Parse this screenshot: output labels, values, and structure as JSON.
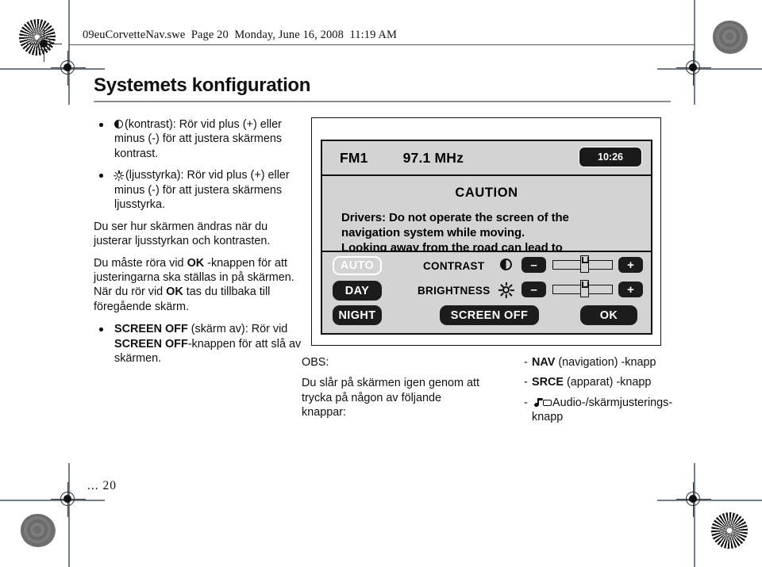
{
  "print_header": {
    "text": "09euCorvetteNav.swe  Page 20  Monday, June 16, 2008  11:19 AM"
  },
  "page": {
    "title": "Systemets konfiguration",
    "page_number": "... 20"
  },
  "left_column": {
    "bullets": [
      {
        "icon": "contrast-icon",
        "text": "(kontrast): Rör vid plus (+) eller minus (-) för att justera skärmens kontrast."
      },
      {
        "icon": "brightness-icon",
        "text": "(ljusstyrka): Rör vid plus (+) eller minus (-) för att justera skärmens ljusstyrka."
      }
    ],
    "paragraph_1": "Du ser hur skärmen ändras när du justerar ljusstyrkan och kontrasten.",
    "paragraph_2_parts": {
      "a": "Du måste röra vid ",
      "b_bold": "OK",
      "c": " -knappen för att justeringarna ska ställas in på skärmen. När du rör vid ",
      "d_bold": "OK",
      "e": " tas du tillbaka till föregående skärm."
    },
    "bullet_3_parts": {
      "a_bold": "SCREEN OFF",
      "b": " (skärm av): Rör vid ",
      "c_bold": "SCREEN OFF",
      "d": "-knappen för att slå av skärmen."
    }
  },
  "screen": {
    "topbar": {
      "band": "FM1",
      "frequency": "97.1 MHz",
      "clock": "10:26"
    },
    "caution": {
      "title": "CAUTION",
      "line_1": "Drivers: Do not operate the screen of the",
      "line_2": "navigation system while moving.",
      "line_3_clipped": "Looking away from the road can lead to"
    },
    "panel": {
      "auto_button": "AUTO",
      "day_button": "DAY",
      "night_button": "NIGHT",
      "screen_off_button": "SCREEN OFF",
      "ok_button": "OK",
      "contrast_label": "CONTRAST",
      "brightness_label": "BRIGHTNESS",
      "minus_label": "–",
      "plus_label": "+",
      "contrast_value_pct": 52,
      "brightness_value_pct": 52
    }
  },
  "note_left": {
    "heading": "OBS:",
    "body": "Du slår på skärmen igen genom att trycka på någon av följande knappar:"
  },
  "note_right": {
    "items": [
      {
        "dash": "-",
        "bold": "NAV",
        "rest": " (navigation) -knapp"
      },
      {
        "dash": "-",
        "bold": "SRCE",
        "rest": " (apparat) -knapp"
      },
      {
        "dash": "-",
        "icon": "audio-screen-icon",
        "rest": "Audio-/skärmjusterings-",
        "rest2": "knapp"
      }
    ]
  },
  "colors": {
    "screen_bg": "#d3d3d3",
    "button_dark": "#1c1c1c",
    "ink": "#111111",
    "rule": "#8d8d8d"
  }
}
